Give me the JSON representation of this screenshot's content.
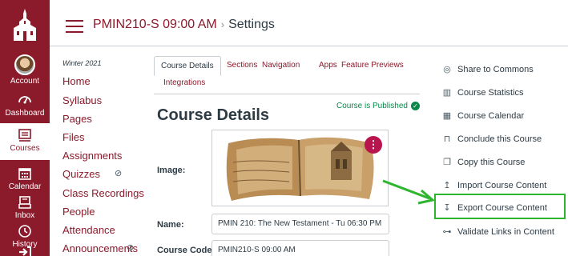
{
  "global_nav": {
    "items": [
      {
        "label": "Account",
        "icon": "avatar"
      },
      {
        "label": "Dashboard",
        "icon": "dashboard-icon"
      },
      {
        "label": "Courses",
        "icon": "courses-icon"
      },
      {
        "label": "Calendar",
        "icon": "calendar-icon"
      },
      {
        "label": "Inbox",
        "icon": "inbox-icon"
      },
      {
        "label": "History",
        "icon": "history-icon"
      }
    ]
  },
  "header": {
    "course": "PMIN210-S 09:00 AM",
    "separator": "›",
    "current": "Settings"
  },
  "course_nav": {
    "term": "Winter 2021",
    "items": [
      "Home",
      "Syllabus",
      "Pages",
      "Files",
      "Assignments",
      "Quizzes",
      "Class Recordings",
      "People",
      "Attendance",
      "Announcements"
    ]
  },
  "tabs": [
    "Course Details",
    "Sections",
    "Navigation",
    "Apps",
    "Feature Previews",
    "Integrations"
  ],
  "main": {
    "title": "Course Details",
    "published": "Course is Published",
    "image_label": "Image:",
    "name_label": "Name:",
    "name_value": "PMIN 210: The New Testament - Tu 06:30 PM",
    "code_label": "Course Code:",
    "code_value": "PMIN210-S 09:00 AM",
    "kebab": "⋮"
  },
  "sidebar": {
    "items": [
      {
        "label": "Share to Commons",
        "icon": "commons-icon"
      },
      {
        "label": "Course Statistics",
        "icon": "statistics-icon"
      },
      {
        "label": "Course Calendar",
        "icon": "calendar-icon"
      },
      {
        "label": "Conclude this Course",
        "icon": "lock-icon"
      },
      {
        "label": "Copy this Course",
        "icon": "copy-icon"
      },
      {
        "label": "Import Course Content",
        "icon": "import-icon"
      },
      {
        "label": "Export Course Content",
        "icon": "export-icon"
      },
      {
        "label": "Validate Links in Content",
        "icon": "link-icon"
      }
    ]
  },
  "colors": {
    "brand": "#8b1a2b",
    "published": "#0b874b",
    "highlight": "#2db52d",
    "kebab": "#b8144e"
  }
}
